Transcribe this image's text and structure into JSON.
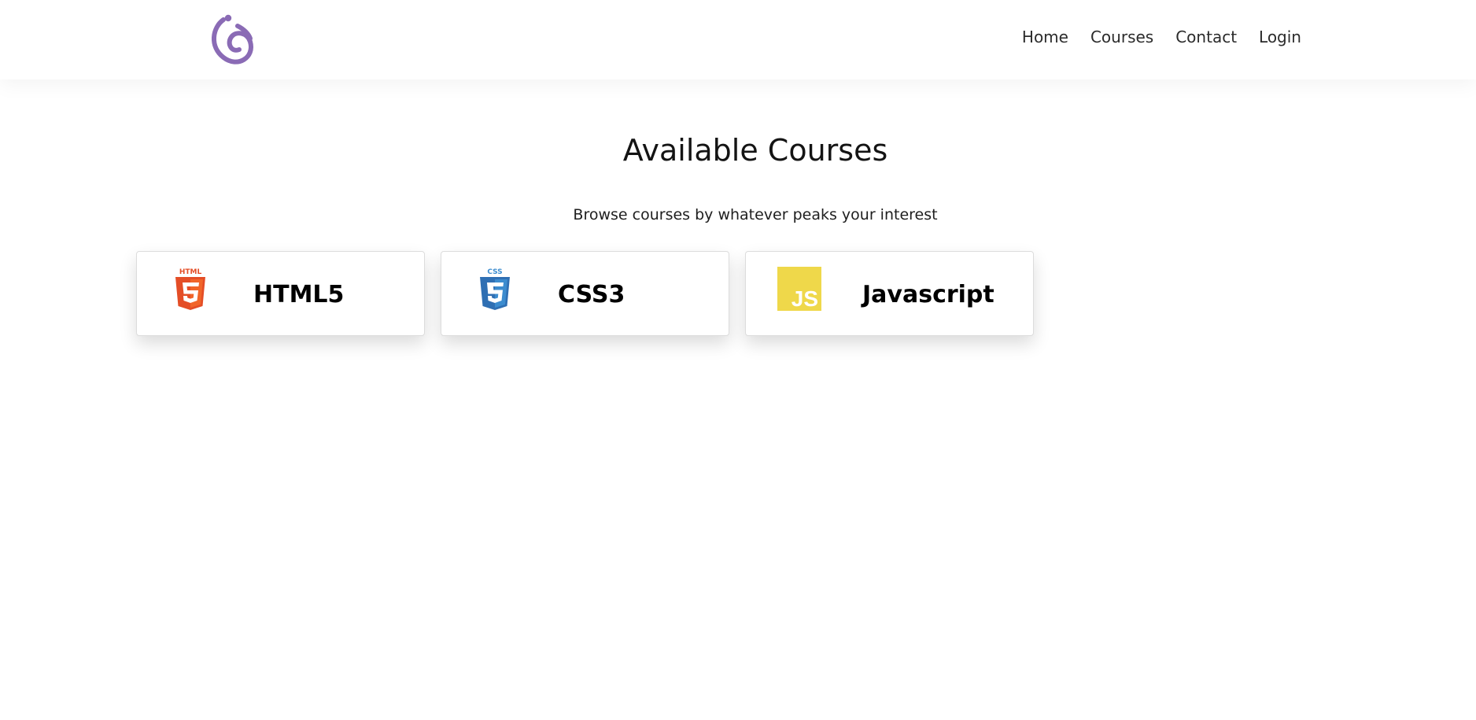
{
  "header": {
    "logo_icon": "logo-spiral-icon",
    "brand_color": "#8a6bb5",
    "nav": [
      {
        "label": "Home"
      },
      {
        "label": "Courses"
      },
      {
        "label": "Contact"
      },
      {
        "label": "Login"
      }
    ]
  },
  "main": {
    "title": "Available Courses",
    "subtitle": "Browse courses by whatever peaks your interest",
    "courses": [
      {
        "label": "HTML5",
        "icon": "html5-icon",
        "icon_text": "HTML",
        "color": "#e44d26"
      },
      {
        "label": "CSS3",
        "icon": "css3-icon",
        "icon_text": "CSS",
        "color": "#3c8ccf"
      },
      {
        "label": "Javascript",
        "icon": "javascript-icon",
        "icon_text": "JS",
        "color": "#efd84a"
      }
    ]
  }
}
